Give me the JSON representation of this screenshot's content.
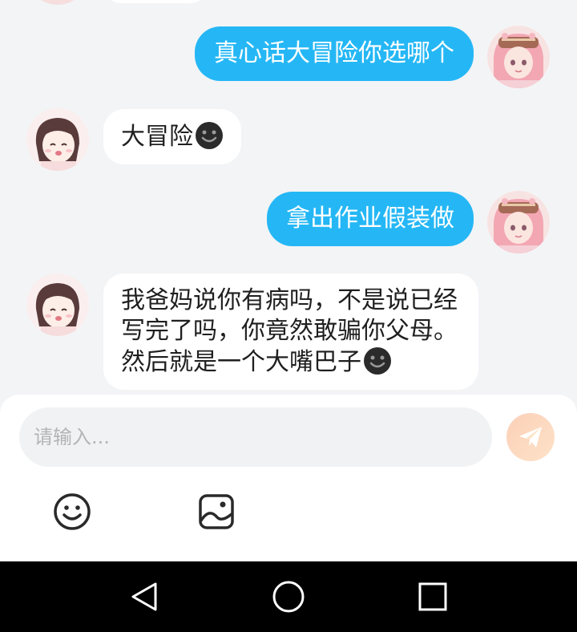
{
  "messages": [
    {
      "side": "out",
      "text": "真心话大冒险你选哪个",
      "emoji": ""
    },
    {
      "side": "in",
      "text": "大冒险",
      "emoji": "smile-icon"
    },
    {
      "side": "out",
      "text": "拿出作业假装做",
      "emoji": ""
    },
    {
      "side": "in",
      "text": "我爸妈说你有病吗，不是说已经写完了吗，你竟然敢骗你父母。然后就是一个大嘴巴子",
      "emoji": "smile-icon"
    }
  ],
  "input": {
    "placeholder": "请输入...",
    "value": ""
  },
  "toolbar": {
    "emoji_icon": "emoji-icon",
    "image_icon": "image-icon",
    "send_icon": "send-icon"
  },
  "nav": {
    "back_icon": "back-triangle-icon",
    "home_icon": "home-circle-icon",
    "recent_icon": "recent-square-icon"
  },
  "colors": {
    "outgoing_bubble": "#25b7f5",
    "incoming_bubble": "#ffffff",
    "background": "#f3f4f6",
    "send_button": "#fbcfb8"
  }
}
